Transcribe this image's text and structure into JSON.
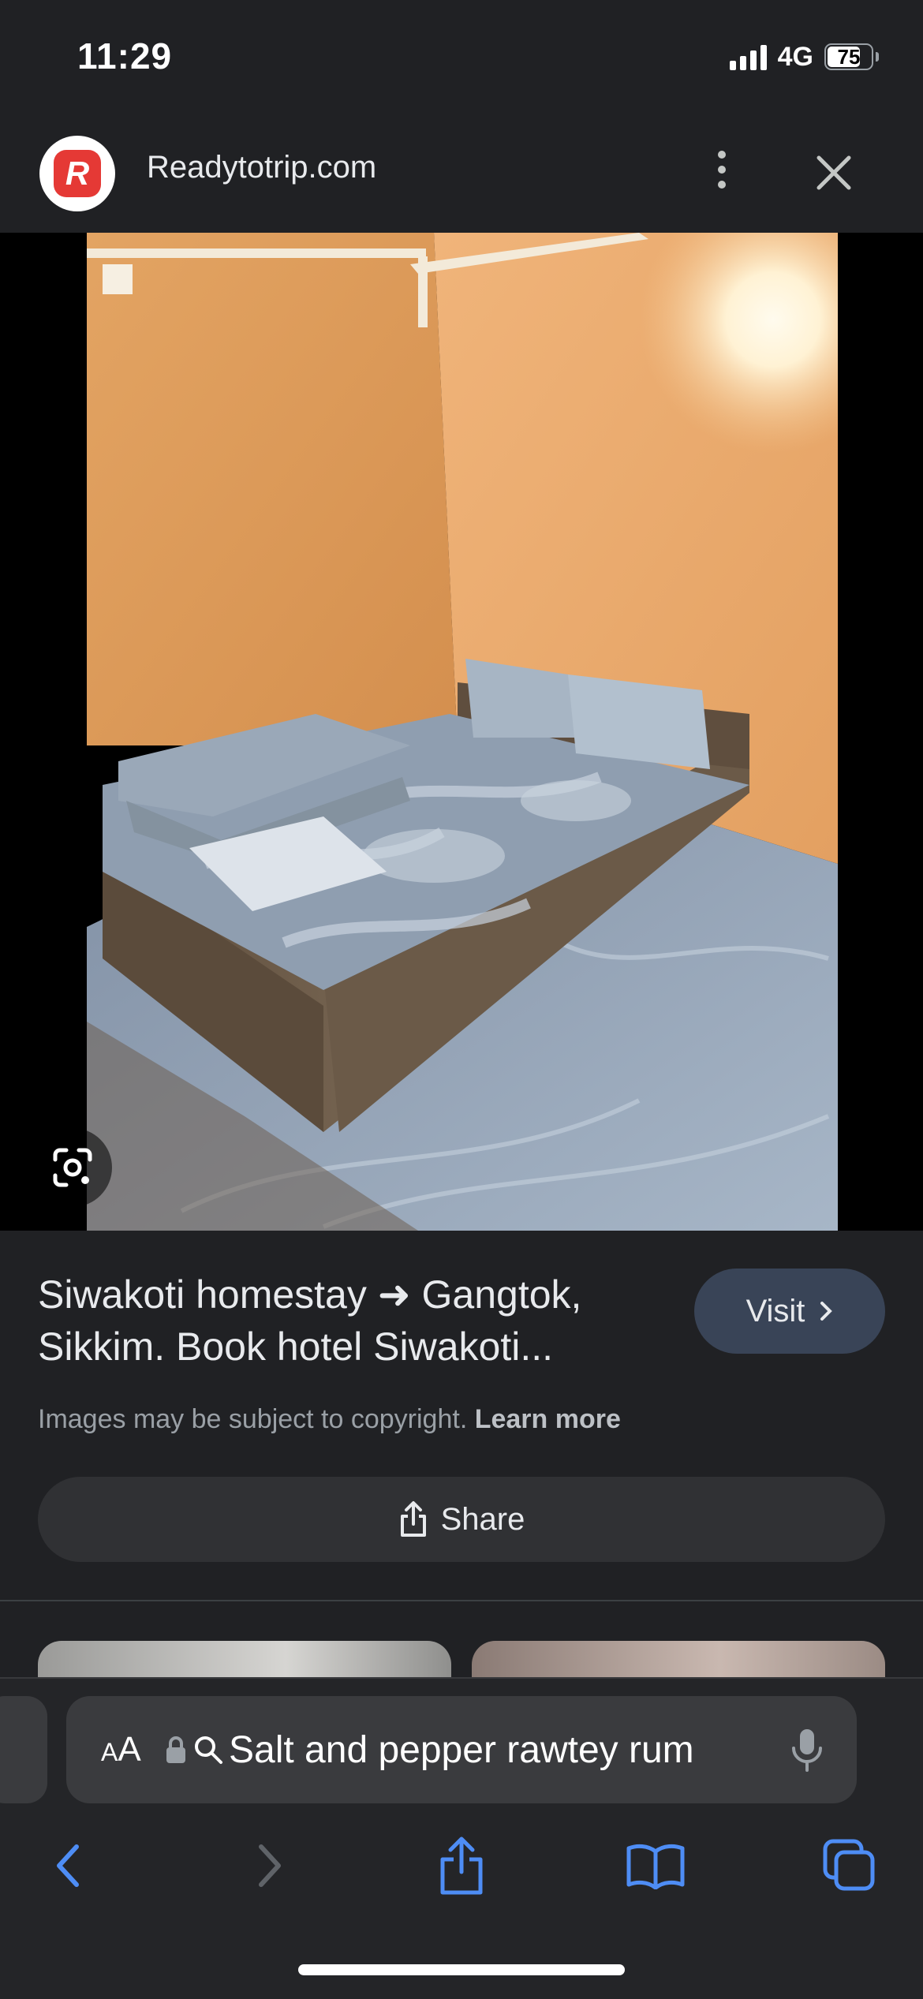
{
  "status_bar": {
    "time": "11:29",
    "network": "4G",
    "battery": "75"
  },
  "header": {
    "logo_letter": "R",
    "site_name": "Readytotrip.com"
  },
  "result": {
    "title": "Siwakoti homestay ➜ Gangtok, Sikkim. Book hotel Siwakoti...",
    "visit_label": "Visit",
    "copyright_text": "Images may be subject to copyright.",
    "learn_more_label": "Learn more",
    "share_label": "Share"
  },
  "safari": {
    "aa_big": "A",
    "aa_small": "A",
    "search_text": "Salt and pepper rawtey rum"
  },
  "colors": {
    "background": "#202124",
    "accent_blue": "#4e8df5",
    "visit_button": "#394457",
    "logo_red": "#e53935"
  }
}
